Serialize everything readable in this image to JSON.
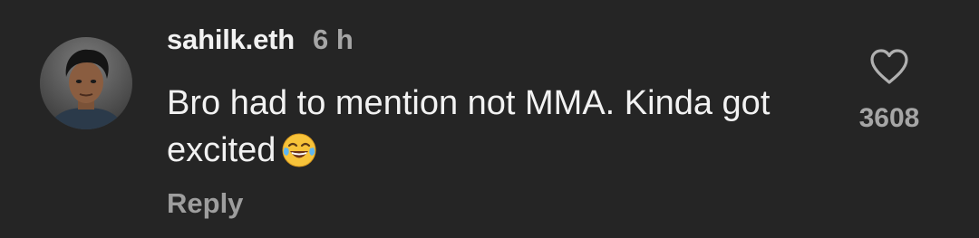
{
  "comment": {
    "username": "sahilk.eth",
    "time": "6 h",
    "text": "Bro had to mention not MMA. Kinda got excited",
    "emoji": "face-with-tears-of-joy",
    "reply_label": "Reply",
    "like_count": "3608",
    "like_icon": "heart-outline-icon",
    "avatar": "profile-photo"
  },
  "colors": {
    "background": "#252525",
    "primary_text": "#f2f2f2",
    "secondary_text": "#a6a6a6"
  }
}
